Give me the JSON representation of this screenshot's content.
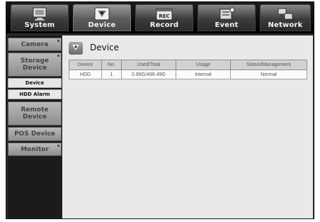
{
  "tabs": [
    {
      "label": "System",
      "icon": "system-monitor-icon"
    },
    {
      "label": "Device",
      "icon": "device-camera-icon"
    },
    {
      "label": "Record",
      "icon": "record-icon",
      "icon_text": "REC"
    },
    {
      "label": "Event",
      "icon": "event-icon"
    },
    {
      "label": "Network",
      "icon": "network-icon"
    }
  ],
  "active_tab": "Device",
  "sidebar": {
    "camera": "Camera",
    "storage_line1": "Storage",
    "storage_line2": "Device",
    "device_sub": "Device",
    "hdd_alarm": "HDD Alarm",
    "remote_line1": "Remote",
    "remote_line2": "Device",
    "pos": "POS Device",
    "monitor": "Monitor"
  },
  "main": {
    "title": "Device",
    "columns": [
      "Device",
      "No.",
      "Used/Total",
      "Usage",
      "Status/Management"
    ],
    "rows": [
      {
        "device": "HDD",
        "no": "1",
        "used_total": "0.99G/499.49G",
        "usage": "Internal",
        "status": "Normal"
      }
    ]
  },
  "colors": {
    "active_tab": "#5c5c5c",
    "panel_bg": "#e9e9e9",
    "frame_bg": "#2a2a2a"
  }
}
